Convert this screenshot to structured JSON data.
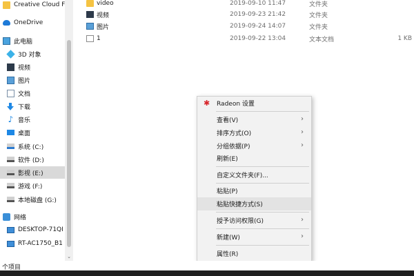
{
  "sidebar": {
    "items": [
      {
        "label": "Creative Cloud F",
        "icon": "folder-icon"
      },
      {
        "label": "OneDrive",
        "icon": "cloud-icon"
      },
      {
        "label": "此电脑",
        "icon": "computer-icon"
      },
      {
        "label": "3D 对象",
        "icon": "3d-objects-icon"
      },
      {
        "label": "视频",
        "icon": "video-icon"
      },
      {
        "label": "图片",
        "icon": "picture-icon"
      },
      {
        "label": "文档",
        "icon": "document-icon"
      },
      {
        "label": "下载",
        "icon": "download-icon"
      },
      {
        "label": "音乐",
        "icon": "music-icon"
      },
      {
        "label": "桌面",
        "icon": "desktop-icon"
      },
      {
        "label": "系统 (C:)",
        "icon": "system-drive-icon"
      },
      {
        "label": "软件 (D:)",
        "icon": "drive-icon"
      },
      {
        "label": "影视 (E:)",
        "icon": "drive-icon",
        "selected": true
      },
      {
        "label": "游戏 (F:)",
        "icon": "drive-icon"
      },
      {
        "label": "本地磁盘 (G:)",
        "icon": "drive-icon"
      },
      {
        "label": "网络",
        "icon": "network-icon"
      },
      {
        "label": "DESKTOP-71QI",
        "icon": "monitor-icon"
      },
      {
        "label": "RT-AC1750_B1",
        "icon": "monitor-icon"
      }
    ]
  },
  "files": [
    {
      "name": "video",
      "date": "2019-09-10 11:47",
      "type": "文件夹",
      "size": "",
      "icon": "folder-icon"
    },
    {
      "name": "视频",
      "date": "2019-09-23 21:42",
      "type": "文件夹",
      "size": "",
      "icon": "video-folder-icon"
    },
    {
      "name": "图片",
      "date": "2019-09-24 14:07",
      "type": "文件夹",
      "size": "",
      "icon": "picture-folder-icon"
    },
    {
      "name": "1",
      "date": "2019-09-22 13:04",
      "type": "文本文档",
      "size": "1 KB",
      "icon": "text-file-icon"
    }
  ],
  "context_menu": {
    "items": [
      {
        "label": "Radeon 设置",
        "icon": "radeon-icon"
      },
      {
        "label": "查看(V)",
        "submenu": true
      },
      {
        "label": "排序方式(O)",
        "submenu": true
      },
      {
        "label": "分组依据(P)",
        "submenu": true
      },
      {
        "label": "刷新(E)"
      },
      {
        "label": "自定义文件夹(F)..."
      },
      {
        "label": "粘贴(P)"
      },
      {
        "label": "粘贴快捷方式(S)",
        "hover": true
      },
      {
        "label": "授予访问权限(G)",
        "submenu": true
      },
      {
        "label": "新建(W)",
        "submenu": true
      },
      {
        "label": "属性(R)"
      }
    ],
    "chevron_glyph": "›",
    "radeon_glyph": "✱"
  },
  "status_bar": {
    "text": "个项目"
  },
  "scrollbar": {
    "down_arrow": "⌄"
  },
  "colors": {
    "accent": "#1e88e5",
    "radeon": "#d8242a",
    "selected": "#d9d9d9"
  }
}
